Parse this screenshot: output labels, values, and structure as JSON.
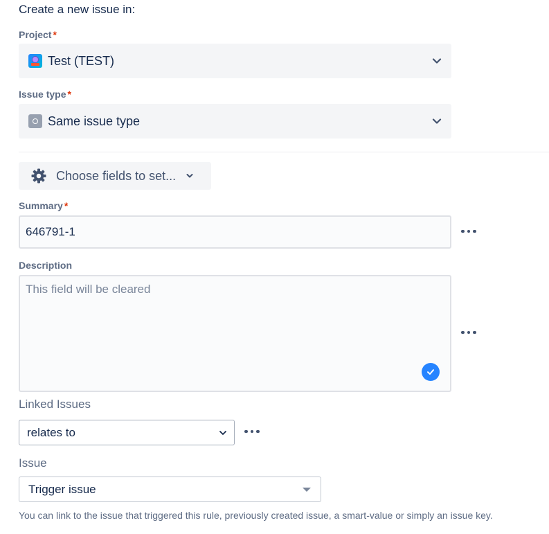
{
  "heading": "Create a new issue in:",
  "project": {
    "label": "Project",
    "required_mark": "*",
    "value": "Test (TEST)",
    "icon": "project-avatar-icon"
  },
  "issue_type": {
    "label": "Issue type",
    "required_mark": "*",
    "value": "Same issue type",
    "icon": "issue-type-icon"
  },
  "choose_fields": {
    "label": "Choose fields to set...",
    "icon": "gear-icon"
  },
  "summary": {
    "label": "Summary",
    "required_mark": "*",
    "value": "646791-1"
  },
  "description": {
    "label": "Description",
    "placeholder": "This field will be cleared"
  },
  "linked_issues": {
    "label": "Linked Issues",
    "relation": "relates to"
  },
  "issue": {
    "label": "Issue",
    "value": "Trigger issue",
    "help": "You can link to the issue that triggered this rule, previously created issue, a smart-value or simply an issue key."
  },
  "colors": {
    "text": "#172b4d",
    "label": "#5e6c84",
    "required": "#de350b",
    "field_bg": "#f4f5f7",
    "accent": "#2684ff"
  }
}
